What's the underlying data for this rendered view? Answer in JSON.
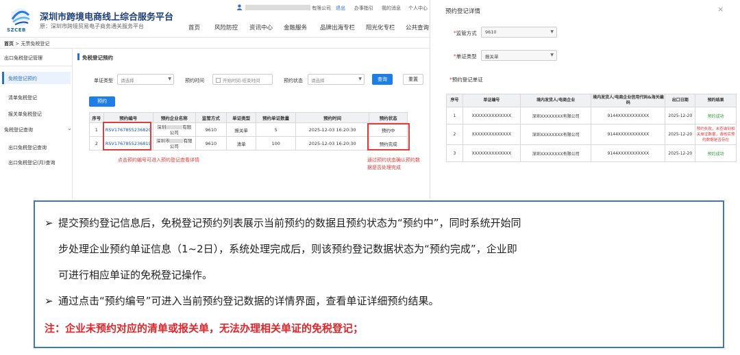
{
  "header": {
    "site_title": "深圳市跨境电商线上综合服务平台",
    "site_subtitle": "原：深圳市跨境贸易电子商务通关服务平台",
    "logo_caption": "SZCEB",
    "company_suffix": "有限公司",
    "top_links": [
      "退出",
      "办事指引",
      "我的消息",
      "个人中心"
    ],
    "nav": [
      "首页",
      "风险防控",
      "资讯中心",
      "金融服务",
      "品牌出海专栏",
      "阳光化专栏",
      "公共查询"
    ]
  },
  "breadcrumb": {
    "home": "首页",
    "sep": " > ",
    "current": "无票免税登记"
  },
  "sidebar": {
    "items": [
      {
        "label": "出口免税登记管理"
      },
      {
        "label": "免税登记预约"
      },
      {
        "label": "清单免税登记"
      },
      {
        "label": "报关单免税登记"
      },
      {
        "label": "免税登记查询"
      },
      {
        "label": "出口免税登记查询"
      },
      {
        "label": "出口免税登记(月)查询"
      }
    ]
  },
  "form": {
    "section_title": "免税登记预约",
    "doc_type_label": "单证类型",
    "doc_type_placeholder": "请选择",
    "time_label": "预约时间",
    "time_placeholder": "开始时间-结束时间",
    "status_label": "预约状态",
    "status_placeholder": "请选择",
    "query_btn": "查询",
    "reset_btn": "重置",
    "reserve_btn": "预约"
  },
  "left_table": {
    "headers": [
      "序号",
      "预约编号",
      "预约企业名称",
      "监管方式",
      "单证类型",
      "预约单证数量",
      "预约时间",
      "预约状态"
    ],
    "rows": [
      {
        "no": "1",
        "code": "RSV1767855236820",
        "company_a": "深圳",
        "company_b": "有限",
        "company_c": "公司",
        "mode": "9610",
        "type": "报关单",
        "qty": "5",
        "time": "2025-12-03 16:20:30",
        "status": "预约中"
      },
      {
        "no": "2",
        "code": "RSV1767855236819",
        "company_a": "深圳市",
        "company_b": "有限",
        "company_c": "公司",
        "mode": "9610",
        "type": "清单",
        "qty": "100",
        "time": "2025-12-03 16:20:30",
        "status": "预约完成"
      }
    ],
    "note_code": "点击预约编号可进入预约登记查看详情",
    "note_status": [
      "通过预约状态确认预约数",
      "据是否处理完成"
    ]
  },
  "panel": {
    "title": "预约登记详情",
    "close": "×",
    "mode_label": "监管方式",
    "mode_value": "9610",
    "doctype_label": "单证类型",
    "doctype_value": "报关单",
    "section_label": "预约登记单证",
    "req": "*",
    "headers": [
      "序号",
      "单证编号",
      "境内发货人/电商企业",
      "境内发货人/电商企业信用代码&海关编码",
      "出口日期",
      "预约结果"
    ],
    "rows": [
      {
        "no": "1",
        "code": "XXXXXXXXXXXXXX",
        "company": "深圳XXXXXXXX有限公司",
        "credit": "9144XXXXXXXXXXX",
        "date": "2025-12-20",
        "result": "预约成功",
        "ok": true
      },
      {
        "no": "2",
        "code": "XXXXXXXXXXXXXX",
        "company": "深圳XXXXXXXX有限公司",
        "credit": "9144XXXXXXXXXXX",
        "date": "2025-12-20",
        "result": "预约失败，未查询到相关单证数据，请核实预约数据是否存在",
        "ok": false
      },
      {
        "no": "3",
        "code": "XXXXXXXXXXXXXX",
        "company": "深圳XXXXXXXX有限公司",
        "credit": "9144XXXXXXXXXXX",
        "date": "2025-12-20",
        "result": "预约成功",
        "ok": true
      }
    ]
  },
  "notes": {
    "bullet": "➢",
    "p1_line1": "提交预约登记信息后，免税登记预约列表展示当前预约的数据且预约状态为“预约中”，同时系统开始同",
    "p1_line2": "步处理企业预约单证信息（1~2日），系统处理完成后，则该预约登记数据状态为“预约完成”，企业即",
    "p1_line3": "可进行相应单证的免税登记操作。",
    "p2": "通过点击“预约编号”可进入当前预约登记数据的详情界面，查看单证详细预约结果。",
    "warning": "注：企业未预约对应的清单或报关单，无法办理相关单证的免税登记；"
  },
  "colors": {
    "accent": "#1e7ee6",
    "red": "#e23b3b",
    "border_blue": "#3d77b8",
    "success": "#2e9b2e"
  }
}
